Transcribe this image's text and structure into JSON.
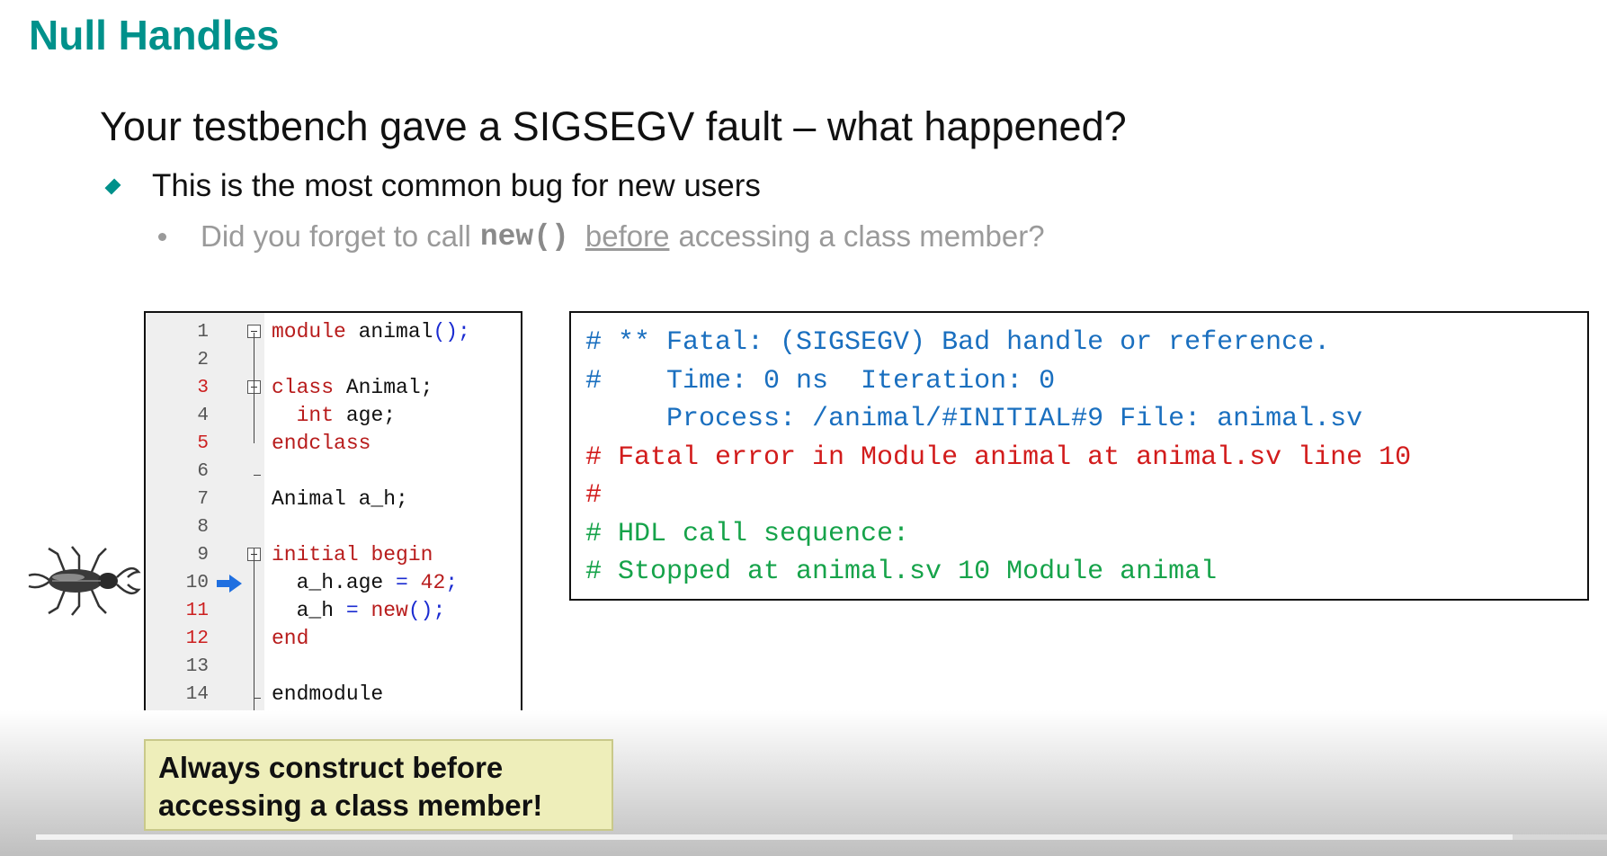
{
  "slide": {
    "title": "Null Handles",
    "subtitle": "Your testbench gave a SIGSEGV fault – what happened?",
    "bullet1": "This is the most common bug for new users",
    "bullet2": {
      "prefix": "Did you forget to call",
      "code": "new()",
      "underlined": "before",
      "suffix": "accessing a class member?"
    }
  },
  "code_editor": {
    "lines": [
      {
        "num": "1",
        "red": false,
        "parts": [
          [
            "kw",
            "module"
          ],
          [
            "txt",
            " animal"
          ],
          [
            "op",
            "();"
          ]
        ]
      },
      {
        "num": "2",
        "red": false,
        "parts": []
      },
      {
        "num": "3",
        "red": true,
        "parts": [
          [
            "kw",
            "class"
          ],
          [
            "txt",
            " Animal;"
          ]
        ]
      },
      {
        "num": "4",
        "red": false,
        "parts": [
          [
            "txt",
            "  "
          ],
          [
            "kw",
            "int"
          ],
          [
            "txt",
            " age;"
          ]
        ]
      },
      {
        "num": "5",
        "red": true,
        "parts": [
          [
            "kw",
            "endclass"
          ]
        ]
      },
      {
        "num": "6",
        "red": false,
        "parts": []
      },
      {
        "num": "7",
        "red": false,
        "parts": [
          [
            "txt",
            "Animal a_h;"
          ]
        ]
      },
      {
        "num": "8",
        "red": false,
        "parts": []
      },
      {
        "num": "9",
        "red": false,
        "parts": [
          [
            "kw",
            "initial"
          ],
          [
            "txt",
            " "
          ],
          [
            "kw",
            "begin"
          ]
        ]
      },
      {
        "num": "10",
        "red": false,
        "parts": [
          [
            "txt",
            "  a_h.age "
          ],
          [
            "op",
            "="
          ],
          [
            "txt",
            " "
          ],
          [
            "kw",
            "42"
          ],
          [
            "op",
            ";"
          ]
        ]
      },
      {
        "num": "11",
        "red": true,
        "parts": [
          [
            "txt",
            "  a_h "
          ],
          [
            "op",
            "="
          ],
          [
            "txt",
            " "
          ],
          [
            "kw",
            "new"
          ],
          [
            "op",
            "();"
          ]
        ]
      },
      {
        "num": "12",
        "red": true,
        "parts": [
          [
            "kw",
            "end"
          ]
        ]
      },
      {
        "num": "13",
        "red": false,
        "parts": []
      },
      {
        "num": "14",
        "red": false,
        "parts": [
          [
            "txt",
            "endmodule"
          ]
        ]
      }
    ],
    "current_line_icon": "arrow-right-icon"
  },
  "console": {
    "lines": [
      {
        "color": "blue",
        "text": "# ** Fatal: (SIGSEGV) Bad handle or reference."
      },
      {
        "color": "blue",
        "text": "#    Time: 0 ns  Iteration: 0"
      },
      {
        "color": "blue",
        "text": "     Process: /animal/#INITIAL#9 File: animal.sv"
      },
      {
        "color": "red",
        "text": "# Fatal error in Module animal at animal.sv line 10"
      },
      {
        "color": "red",
        "text": "#"
      },
      {
        "color": "green",
        "text": "# HDL call sequence:"
      },
      {
        "color": "green",
        "text": "# Stopped at animal.sv 10 Module animal"
      }
    ]
  },
  "callout": {
    "line1": "Always construct before",
    "line2": "accessing a class member!"
  },
  "video": {
    "progress": 0.94
  },
  "colors": {
    "title": "#00918b",
    "keyword": "#b81c1c",
    "operator": "#1a2bd1",
    "console_blue": "#1a6fbf",
    "console_red": "#d21c1c",
    "console_green": "#16a34a",
    "callout_bg": "#eeeeba"
  },
  "icons": [
    "bullet-diamond-icon",
    "bullet-dot-icon",
    "fold-minus-icon",
    "arrow-right-icon",
    "beetle-bug-icon"
  ]
}
